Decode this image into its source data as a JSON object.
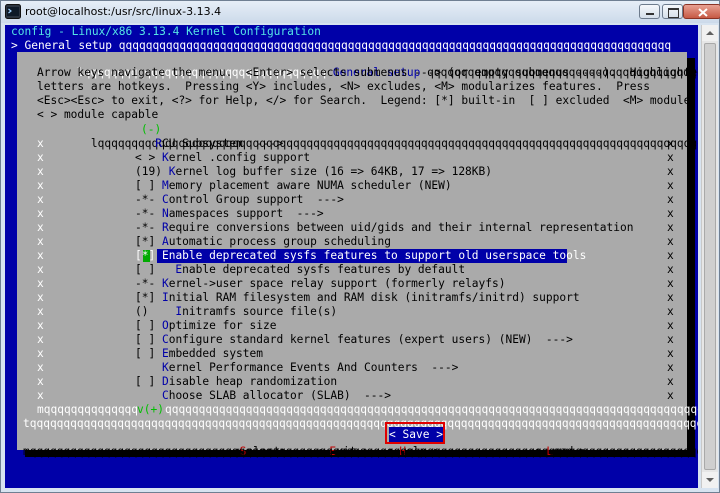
{
  "window": {
    "title": "root@localhost:/usr/src/linux-3.13.4"
  },
  "terminal": {
    "header": "config - Linux/x86 3.13.4 Kernel Configuration",
    "breadcrumb": "> General setup qqqqqqqqqqqqqqqqqqqqqqqqqqqqqqqqqqqqqqqqqqqqqqqqqqqqqqqqqqqqqqqqqqqqqqqqqqqqqqqqqq"
  },
  "dialog": {
    "top_border": "lqqqqqqqqqqqqqqqqqqqqqqqqqqqqqqqqqqqq",
    "title": " General setup ",
    "top_border_right": "qqqqqqqqqqqqqqqqqqqqqqqqqqqqqqqqqqqqqqqqk",
    "help_lines": [
      "Arrow keys navigate the menu.  <Enter> selects submenus ---> (or empty submenus ----).  Highlighted",
      "letters are hotkeys.  Pressing <Y> includes, <N> excludes, <M> modularizes features.  Press",
      "<Esc><Esc> to exit, <?> for Help, </> for Search.  Legend: [*] built-in  [ ] excluded  <M> module",
      "< > module capable"
    ],
    "menu_top_border": "lqqqqqqqqqqqqqqqqqqqqqqqqqqqqqqqqqqqqqqqqqqqqqqqqqqqqqqqqqqqqqqqqqqqqqqqqqqqqqqqqqqqqqqqqqqqqqqqqqqqqqqk",
    "menu_top_marker": "(-)",
    "menu_items": [
      {
        "prefix": "   ",
        "hot": "R",
        "rest": "CU Subsystem  --->"
      },
      {
        "prefix": "< > ",
        "hot": "K",
        "rest": "ernel .config support"
      },
      {
        "prefix": "(19) ",
        "hot": "K",
        "rest": "ernel log buffer size (16 => 64KB, 17 => 128KB)"
      },
      {
        "prefix": "[ ] ",
        "hot": "M",
        "rest": "emory placement aware NUMA scheduler (NEW)"
      },
      {
        "prefix": "-*- ",
        "hot": "C",
        "rest": "ontrol Group support  --->"
      },
      {
        "prefix": "-*- ",
        "hot": "N",
        "rest": "amespaces support  --->"
      },
      {
        "prefix": "-*- ",
        "hot": "R",
        "rest": "equire conversions between uid/gids and their internal representation"
      },
      {
        "prefix": "[*] ",
        "hot": "A",
        "rest": "utomatic process group scheduling"
      },
      {
        "prefix": "[*] ",
        "hot": "E",
        "rest": "nable deprecated sysfs features to support old userspace tools"
      },
      {
        "prefix": "[ ]   ",
        "hot": "E",
        "rest": "nable deprecated sysfs features by default"
      },
      {
        "prefix": "-*- ",
        "hot": "K",
        "rest": "ernel->user space relay support (formerly relayfs)"
      },
      {
        "prefix": "[*] ",
        "hot": "I",
        "rest": "nitial RAM filesystem and RAM disk (initramfs/initrd) support"
      },
      {
        "prefix": "()    ",
        "hot": "I",
        "rest": "nitramfs source file(s)"
      },
      {
        "prefix": "[ ] ",
        "hot": "O",
        "rest": "ptimize for size"
      },
      {
        "prefix": "[ ] ",
        "hot": "C",
        "rest": "onfigure standard kernel features (expert users) (NEW)  --->"
      },
      {
        "prefix": "[ ] ",
        "hot": "E",
        "rest": "mbedded system"
      },
      {
        "prefix": "    ",
        "hot": "K",
        "rest": "ernel Performance Events And Counters  --->"
      },
      {
        "prefix": "[ ] ",
        "hot": "D",
        "rest": "isable heap randomization"
      },
      {
        "prefix": "    ",
        "hot": "C",
        "rest": "hoose SLAB allocator (SLAB)  --->"
      }
    ],
    "selected_index": 8,
    "menu_bottom_border": "mqqqqqqqqqqqqqqqqqqqqqqqqqqqqqqqqqqqqqqqqqqqqqqqqqqqqqqqqqqqqqqqqqqqqqqqqqqqqqqqqqqqqqqqqqqqqqqqqqqqqqj",
    "menu_bottom_marker": "v(+)",
    "separator": "tqqqqqqqqqqqqqqqqqqqqqqqqqqqqqqqqqqqqqqqqqqqqqqqqqqqqqqqqqqqqqqqqqqqqqqqqqqqqqqqqqqqqqqqqqqqqqqqqqqqqqqqqqqu",
    "bottom_border": "mqqqqqqqqqqqqqqqqqqqqqqqqqqqqqqqqqqqqqqqqqqqqqqqqqqqqqqqqqqqqqqqqqqqqqqqqqqqqqqqqqqqqqqqqqqqqqqqqqqqqqqqqqqj",
    "buttons": {
      "select": {
        "open": "<",
        "hot": "S",
        "rest": "elect",
        "close": ">"
      },
      "exit": {
        "open": "< ",
        "hot": "E",
        "rest": "xit",
        "close": " >"
      },
      "help": {
        "open": "< ",
        "hot": "H",
        "rest": "elp",
        "close": " >"
      },
      "save": "< Save >",
      "load": {
        "open": "< ",
        "hot": "L",
        "rest": "oad",
        "close": " >"
      }
    }
  },
  "colors": {
    "terminal_bg": "#0000a8",
    "dialog_bg": "#aaaaaa",
    "highlight": "#0000a8",
    "save_outline": "#e00000"
  }
}
